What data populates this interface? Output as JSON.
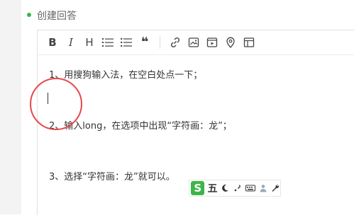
{
  "section": {
    "title": "创建回答"
  },
  "toolbar": {
    "bold": "B",
    "italic": "I",
    "heading": "H",
    "quote": "❝",
    "icons": [
      "bold-icon",
      "italic-icon",
      "heading-icon",
      "ordered-list-icon",
      "unordered-list-icon",
      "quote-icon",
      "link-icon",
      "image-icon",
      "video-icon",
      "location-icon",
      "table-icon"
    ]
  },
  "editor": {
    "line1": "1、用搜狗输入法，在空白处点一下；",
    "line2": "2、输入long，在选项中出现“字符画：龙”；",
    "line3": "3、选择“字符画：龙”就可以。"
  },
  "ime": {
    "logo": "S",
    "mode": "五",
    "icons": [
      "moon-icon",
      "punctuation-icon",
      "keyboard-icon",
      "person-icon",
      "wrench-icon"
    ]
  },
  "colors": {
    "accent": "#3fb24f",
    "annotation_red": "#e54848"
  }
}
